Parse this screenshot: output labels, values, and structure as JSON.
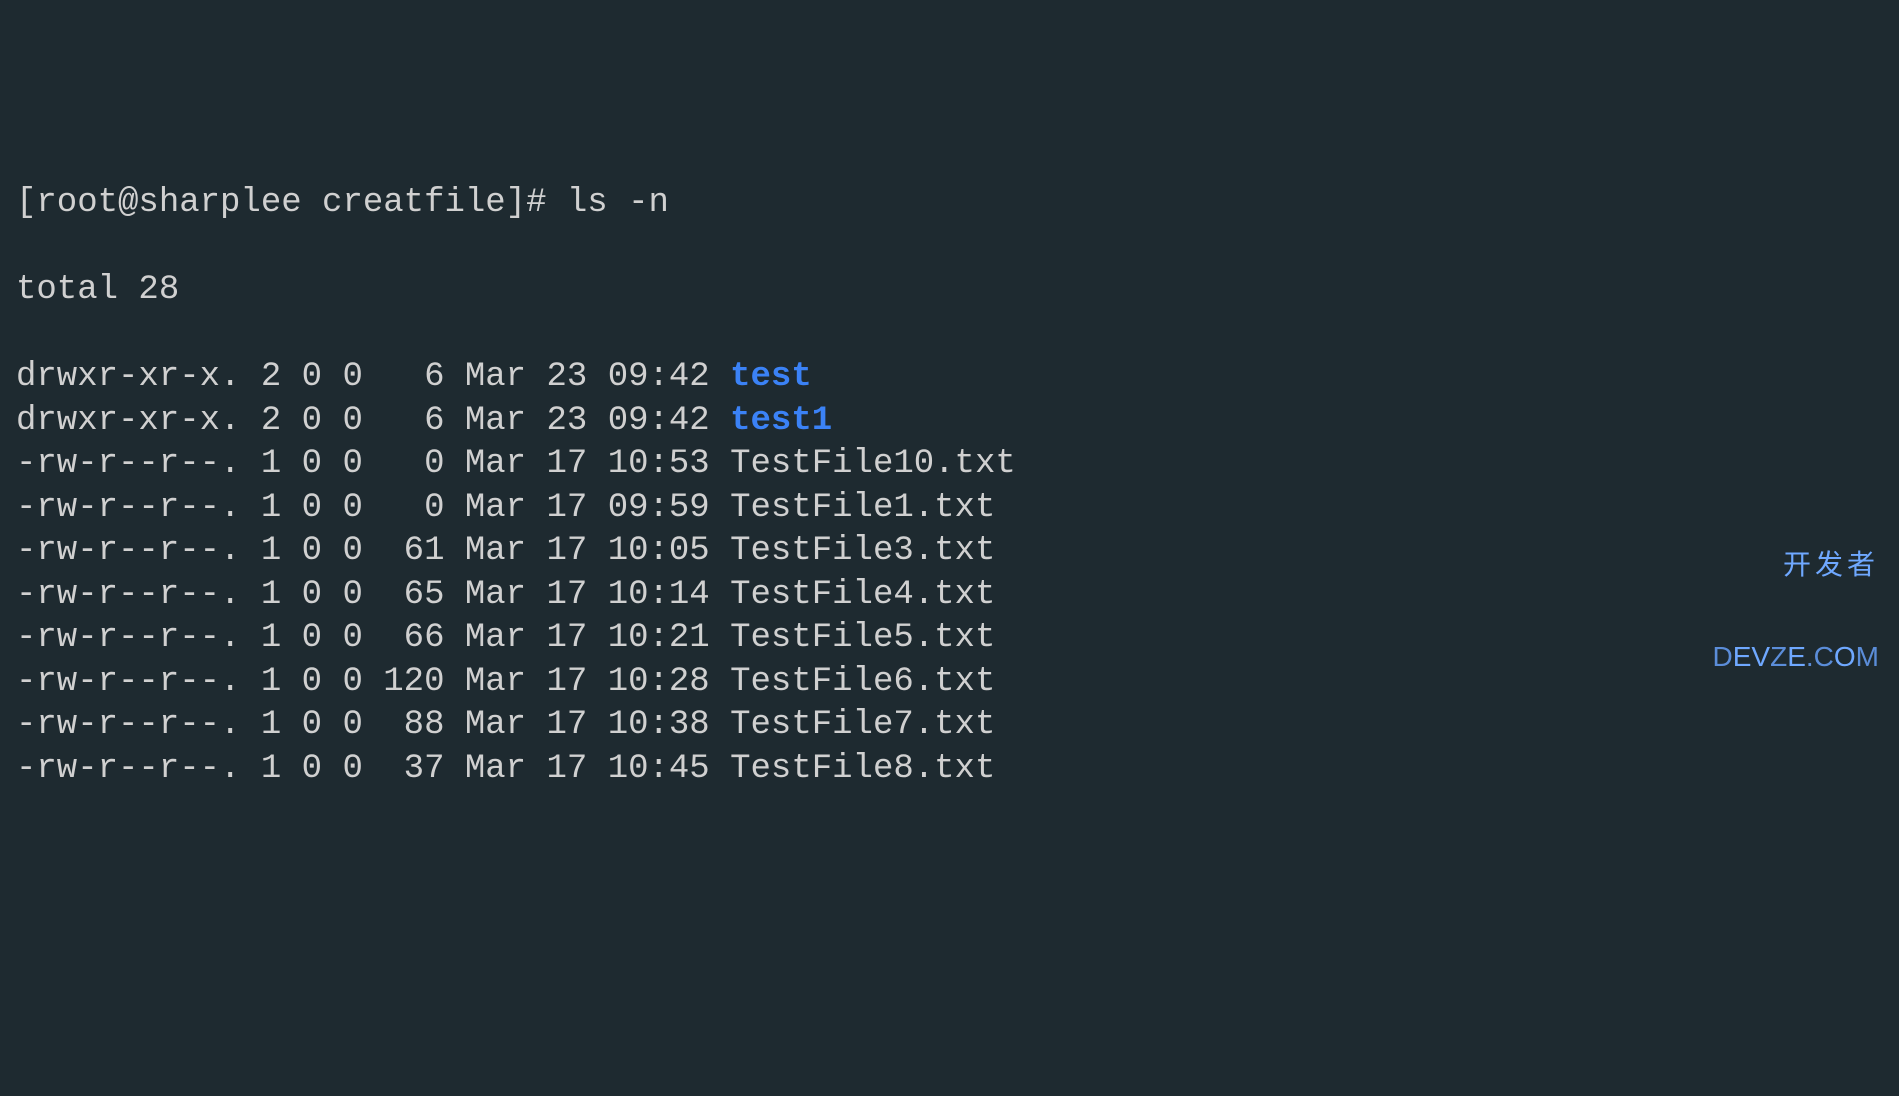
{
  "prompt": {
    "prefix": "[root@sharplee creatfile]# ",
    "command": "ls -n"
  },
  "total_line": "total 28",
  "entries": [
    {
      "perms": "drwxr-xr-x.",
      "links": "2",
      "uid": "0",
      "gid": "0",
      "size": "  6",
      "month": "Mar",
      "day": "23",
      "time": "09:42",
      "name": "test",
      "is_dir": true
    },
    {
      "perms": "drwxr-xr-x.",
      "links": "2",
      "uid": "0",
      "gid": "0",
      "size": "  6",
      "month": "Mar",
      "day": "23",
      "time": "09:42",
      "name": "test1",
      "is_dir": true
    },
    {
      "perms": "-rw-r--r--.",
      "links": "1",
      "uid": "0",
      "gid": "0",
      "size": "  0",
      "month": "Mar",
      "day": "17",
      "time": "10:53",
      "name": "TestFile10.txt",
      "is_dir": false
    },
    {
      "perms": "-rw-r--r--.",
      "links": "1",
      "uid": "0",
      "gid": "0",
      "size": "  0",
      "month": "Mar",
      "day": "17",
      "time": "09:59",
      "name": "TestFile1.txt",
      "is_dir": false
    },
    {
      "perms": "-rw-r--r--.",
      "links": "1",
      "uid": "0",
      "gid": "0",
      "size": " 61",
      "month": "Mar",
      "day": "17",
      "time": "10:05",
      "name": "TestFile3.txt",
      "is_dir": false
    },
    {
      "perms": "-rw-r--r--.",
      "links": "1",
      "uid": "0",
      "gid": "0",
      "size": " 65",
      "month": "Mar",
      "day": "17",
      "time": "10:14",
      "name": "TestFile4.txt",
      "is_dir": false
    },
    {
      "perms": "-rw-r--r--.",
      "links": "1",
      "uid": "0",
      "gid": "0",
      "size": " 66",
      "month": "Mar",
      "day": "17",
      "time": "10:21",
      "name": "TestFile5.txt",
      "is_dir": false
    },
    {
      "perms": "-rw-r--r--.",
      "links": "1",
      "uid": "0",
      "gid": "0",
      "size": "120",
      "month": "Mar",
      "day": "17",
      "time": "10:28",
      "name": "TestFile6.txt",
      "is_dir": false
    },
    {
      "perms": "-rw-r--r--.",
      "links": "1",
      "uid": "0",
      "gid": "0",
      "size": " 88",
      "month": "Mar",
      "day": "17",
      "time": "10:38",
      "name": "TestFile7.txt",
      "is_dir": false
    },
    {
      "perms": "-rw-r--r--.",
      "links": "1",
      "uid": "0",
      "gid": "0",
      "size": " 37",
      "month": "Mar",
      "day": "17",
      "time": "10:45",
      "name": "TestFile8.txt",
      "is_dir": false
    }
  ],
  "watermark": {
    "top": "开发者",
    "bottom": "DEVZE.COM"
  }
}
